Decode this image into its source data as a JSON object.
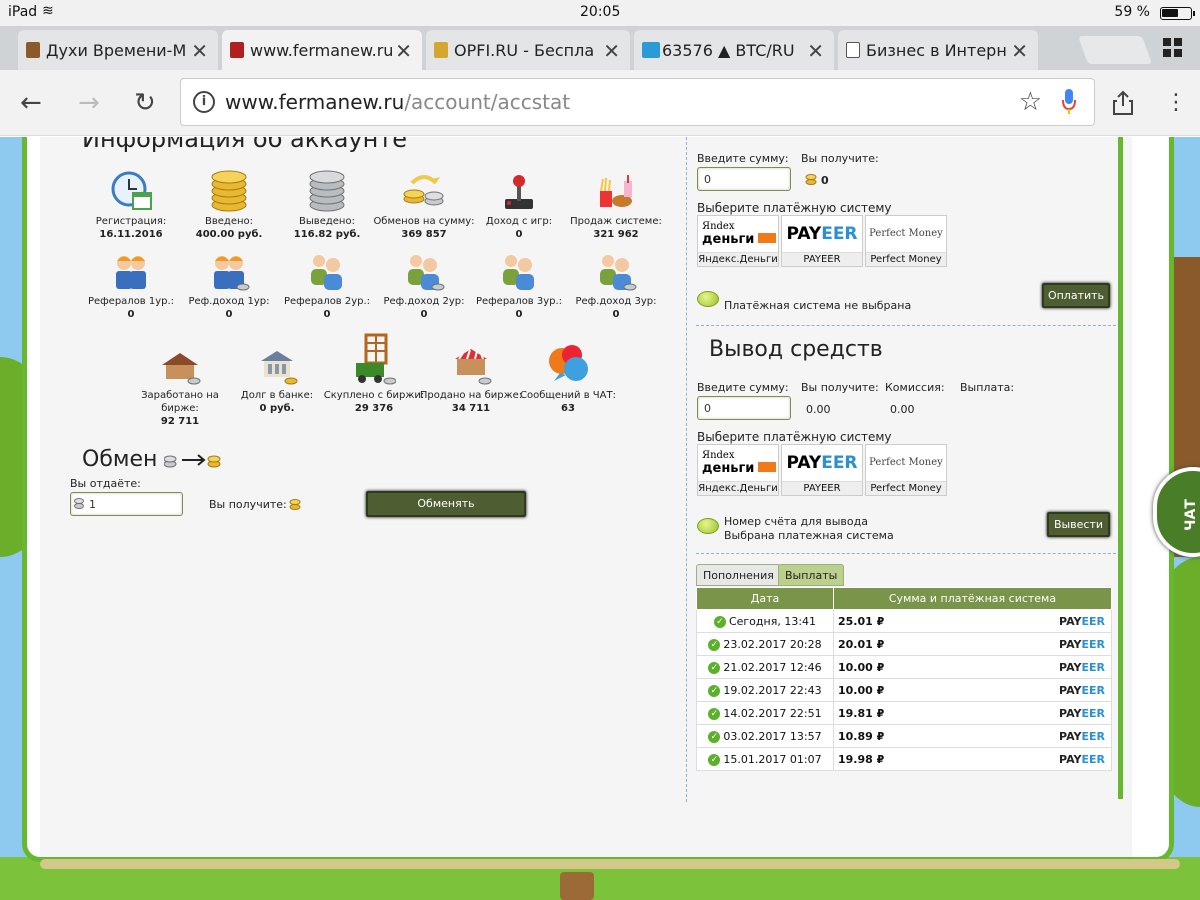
{
  "status": {
    "device": "iPad",
    "time": "20:05",
    "battery": "59 %"
  },
  "tabs": [
    {
      "title": "Духи Времени-М"
    },
    {
      "title": "www.fermanew.ru"
    },
    {
      "title": "OPFI.RU - Беспла"
    },
    {
      "title": "63576 ▲ BTC/RU"
    },
    {
      "title": "Бизнес в Интерн"
    }
  ],
  "toolbar": {
    "url_host": "www.fermanew.ru",
    "url_path": "/account/accstat"
  },
  "account": {
    "title": "Информация об аккаунте",
    "row1": [
      {
        "label": "Регистрация:",
        "value": "16.11.2016",
        "icon": "calendar-clock-icon"
      },
      {
        "label": "Введено:",
        "value": "400.00 руб.",
        "icon": "gold-coins-icon"
      },
      {
        "label": "Выведено:",
        "value": "116.82 руб.",
        "icon": "silver-coins-icon"
      },
      {
        "label": "Обменов на сумму:",
        "value": "369 857",
        "icon": "exchange-coins-icon"
      },
      {
        "label": "Доход с игр:",
        "value": "0",
        "icon": "joystick-icon"
      },
      {
        "label": "Продаж системе:",
        "value": "321 962",
        "icon": "food-icon"
      }
    ],
    "row2": [
      {
        "label": "Рефералов 1ур.:",
        "value": "0"
      },
      {
        "label": "Реф.доход 1ур:",
        "value": "0"
      },
      {
        "label": "Рефералов 2ур.:",
        "value": "0"
      },
      {
        "label": "Реф.доход 2ур:",
        "value": "0"
      },
      {
        "label": "Рефералов 3ур.:",
        "value": "0"
      },
      {
        "label": "Реф.доход 3ур:",
        "value": "0"
      }
    ],
    "row3": [
      {
        "label": "Заработано на бирже:",
        "value": "92 711",
        "icon": "market-building-icon"
      },
      {
        "label": "Долг в банке:",
        "value": "0 руб.",
        "icon": "bank-icon"
      },
      {
        "label": "Скуплено с биржи:",
        "value": "29 376",
        "icon": "cart-icon"
      },
      {
        "label": "Продано на бирже:",
        "value": "34 711",
        "icon": "stall-icon"
      },
      {
        "label": "Сообщений в ЧАТ:",
        "value": "63",
        "icon": "chat-bubbles-icon"
      }
    ]
  },
  "exchange": {
    "title": "Обмен",
    "give_label": "Вы отдаёте:",
    "give_value": "1",
    "get_label": "Вы получите: 1",
    "button": "Обменять"
  },
  "deposit": {
    "amount_label": "Введите сумму:",
    "get_label": "Вы получите:",
    "amount_value": "0",
    "get_value": "0",
    "choose_label": "Выберите платёжную систему",
    "systems": [
      "Яндекс.Деньги",
      "PAYEER",
      "Perfect Money"
    ],
    "status": "Платёжная система не выбрана",
    "button": "Оплатить"
  },
  "withdraw": {
    "title": "Вывод средств",
    "amount_label": "Введите сумму:",
    "get_label": "Вы получите:",
    "fee_label": "Комиссия:",
    "payout_label": "Выплата:",
    "amount_value": "0",
    "get_value": "0.00",
    "fee_value": "0.00",
    "choose_label": "Выберите платёжную систему",
    "systems": [
      "Яндекс.Деньги",
      "PAYEER",
      "Perfect Money"
    ],
    "status1": "Номер счёта для вывода",
    "status2": "Выбрана платежная система",
    "button": "Вывести"
  },
  "history": {
    "tabs": [
      "Пополнения",
      "Выплаты"
    ],
    "headers": [
      "Дата",
      "Сумма и платёжная система"
    ],
    "rows": [
      {
        "date": "Сегодня, 13:41",
        "sum": "25.01 ₽"
      },
      {
        "date": "23.02.2017 20:28",
        "sum": "20.01 ₽"
      },
      {
        "date": "21.02.2017 12:46",
        "sum": "10.00 ₽"
      },
      {
        "date": "19.02.2017 22:43",
        "sum": "10.00 ₽"
      },
      {
        "date": "14.02.2017 22:51",
        "sum": "19.81 ₽"
      },
      {
        "date": "03.02.2017 13:57",
        "sum": "10.89 ₽"
      },
      {
        "date": "15.01.2017 01:07",
        "sum": "19.98 ₽"
      }
    ],
    "system_label_a": "PAY",
    "system_label_b": "EER"
  },
  "logos": {
    "yandex_a": "Яndex",
    "yandex_b": "деньги",
    "payeer_a": "PAY",
    "payeer_b": "EER",
    "pm": "Perfect Money"
  },
  "chat": "ЧАТ",
  "colors": {
    "accent": "#4e5e32",
    "table_header": "#7a944a",
    "frame": "#66b82f",
    "payeer_blue": "#2b8fd6"
  }
}
